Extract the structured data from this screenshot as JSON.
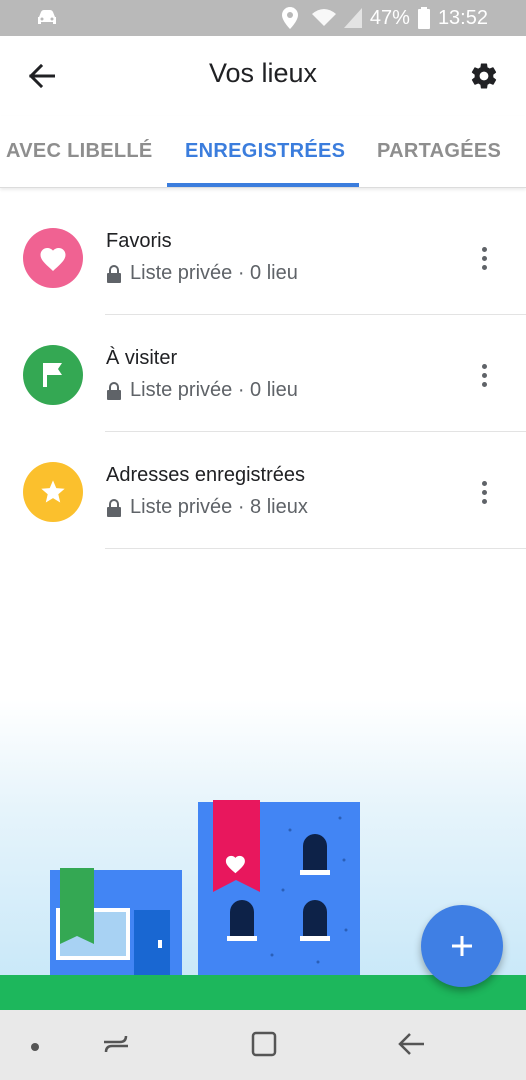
{
  "status_bar": {
    "battery_text": "47%",
    "time": "13:52",
    "icons": [
      "car-icon",
      "location-icon",
      "wifi-icon",
      "signal-icon",
      "battery-icon"
    ]
  },
  "app_bar": {
    "title": "Vos lieux",
    "back_icon": "arrow-back-icon",
    "settings_icon": "gear-icon"
  },
  "tabs": [
    {
      "label": "AVEC LIBELLÉ",
      "selected": false
    },
    {
      "label": "ENREGISTRÉES",
      "selected": true
    },
    {
      "label": "PARTAGÉES",
      "selected": false
    }
  ],
  "lists": [
    {
      "name": "Favoris",
      "meta": "Liste privée · 0 lieu",
      "icon": "heart-icon",
      "color": "#f06292"
    },
    {
      "name": "À visiter",
      "meta": "Liste privée · 0 lieu",
      "icon": "flag-icon",
      "color": "#34a853"
    },
    {
      "name": "Adresses enregistrées",
      "meta": "Liste privée · 8 lieux",
      "icon": "star-icon",
      "color": "#fbc02d"
    }
  ],
  "fab": {
    "icon": "plus-icon",
    "color": "#3f7fe4"
  },
  "nav_bar": {
    "icons": [
      "dot-icon",
      "recents-icon",
      "home-icon",
      "back-icon"
    ]
  },
  "colors": {
    "accent": "#3b7ddd",
    "ground": "#1db75c"
  }
}
